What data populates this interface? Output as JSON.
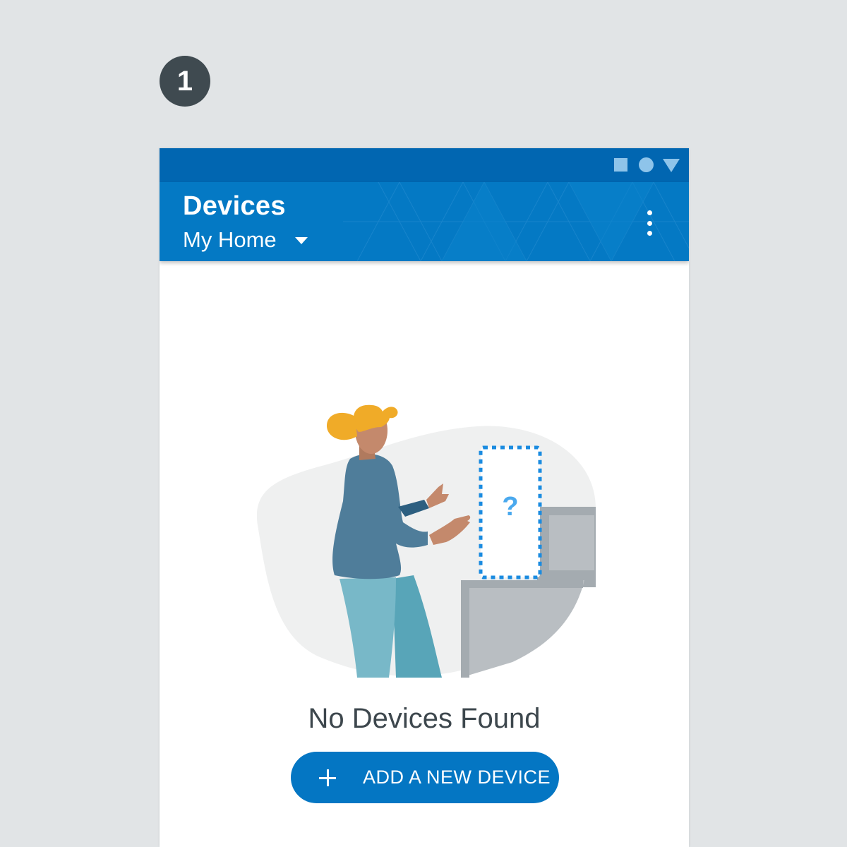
{
  "step_badge": "1",
  "status_bar": {
    "icons": [
      "square-icon",
      "circle-icon",
      "triangle-icon"
    ],
    "color": "#0166b1"
  },
  "app_bar": {
    "title": "Devices",
    "subtitle": "My Home",
    "dropdown_icon": "caret-down-icon",
    "menu_icon": "more-vertical-icon",
    "color": "#0479c4"
  },
  "empty_state": {
    "illustration": "person-looking-for-device",
    "placeholder_glyph": "?",
    "title": "No Devices Found",
    "button_icon": "plus-icon",
    "button_label": "ADD A NEW DEVICE",
    "button_color": "#0476c3"
  }
}
